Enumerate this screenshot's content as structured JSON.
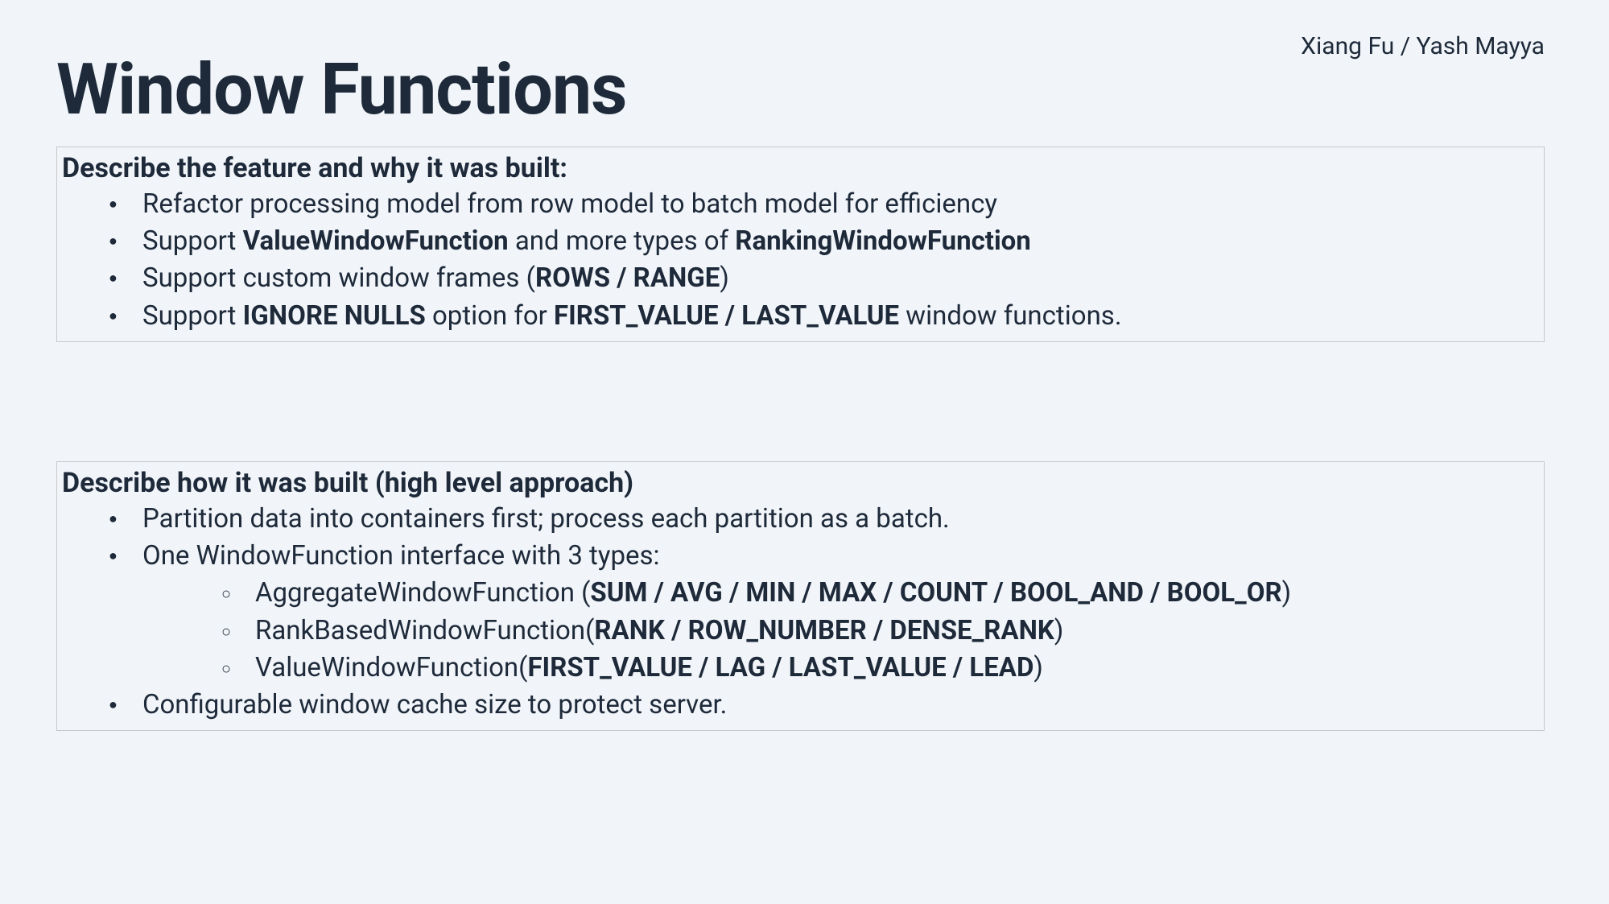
{
  "authors": "Xiang Fu / Yash Mayya",
  "title": "Window Functions",
  "section1": {
    "heading": "Describe the feature and why it was built:",
    "items": {
      "i0": "Refactor processing model from row model to batch model for efficiency",
      "i1_pre": "Support ",
      "i1_b1": "ValueWindowFunction",
      "i1_mid": " and more types of ",
      "i1_b2": "RankingWindowFunction",
      "i2_pre": "Support custom window frames (",
      "i2_b1": "ROWS / RANGE",
      "i2_post": ")",
      "i3_pre": "Support ",
      "i3_b1": "IGNORE NULLS",
      "i3_mid": " option for ",
      "i3_b2": "FIRST_VALUE / LAST_VALUE",
      "i3_post": " window functions."
    }
  },
  "section2": {
    "heading": "Describe how it was built (high level approach)",
    "items": {
      "i0": "Partition data into containers first; process each partition as a batch.",
      "i1": "One WindowFunction interface with 3 types:",
      "sub": {
        "s0_pre": "AggregateWindowFunction (",
        "s0_b": "SUM / AVG / MIN / MAX / COUNT / BOOL_AND / BOOL_OR",
        "s0_post": ")",
        "s1_pre": "RankBasedWindowFunction(",
        "s1_b": "RANK / ROW_NUMBER / DENSE_RANK",
        "s1_post": ")",
        "s2_pre": "ValueWindowFunction(",
        "s2_b": "FIRST_VALUE / LAG / LAST_VALUE / LEAD",
        "s2_post": ")"
      },
      "i2": "Configurable window cache size to protect server."
    }
  }
}
